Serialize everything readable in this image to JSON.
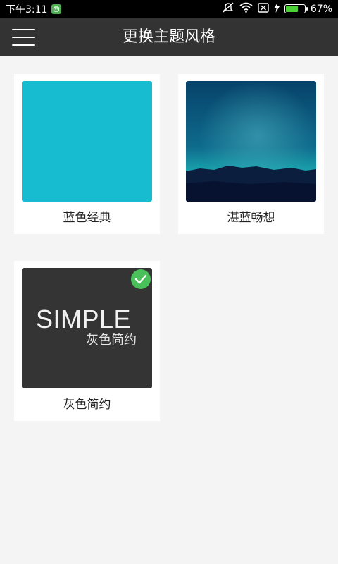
{
  "status_bar": {
    "time": "下午3:11",
    "battery_percent_text": "67%",
    "battery_level": 0.67,
    "icons": [
      "notification-icon",
      "mute-icon",
      "wifi-icon",
      "no-sim-icon",
      "charging-icon",
      "battery-icon"
    ]
  },
  "header": {
    "title": "更换主题风格",
    "menu_icon": "hamburger-menu-icon"
  },
  "themes": [
    {
      "label": "蓝色经典",
      "color": "#17bcd1",
      "selected": false
    },
    {
      "label": "湛蓝畅想",
      "color": "#0a4f7a",
      "selected": false
    },
    {
      "label": "灰色简约",
      "color": "#343434",
      "selected": true,
      "thumb_title": "SIMPLE",
      "thumb_subtitle": "灰色简约"
    }
  ],
  "colors": {
    "title_bar": "#333333",
    "background": "#f4f4f4",
    "selected_badge": "#4ac05a"
  }
}
